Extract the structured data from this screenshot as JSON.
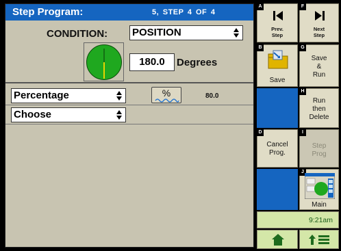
{
  "title": "Step Program:",
  "step_info": "5, STEP 4 OF 4",
  "condition": {
    "label": "CONDITION:",
    "value": "POSITION"
  },
  "degrees": {
    "value": "180.0",
    "unit": "Degrees"
  },
  "row1": {
    "select": "Percentage",
    "button": "%",
    "value": "80.0"
  },
  "row2": {
    "select": "Choose"
  },
  "buttons": {
    "prev": {
      "key": "A",
      "label1": "Prev.",
      "label2": "Step"
    },
    "next": {
      "key": "F",
      "label1": "Next",
      "label2": "Step"
    },
    "save": {
      "key": "B",
      "label": "Save"
    },
    "save_run": {
      "key": "G",
      "label1": "Save",
      "label2": "&",
      "label3": "Run"
    },
    "run_delete": {
      "key": "H",
      "label1": "Run",
      "label2": "then",
      "label3": "Delete"
    },
    "cancel": {
      "key": "D",
      "label1": "Cancel",
      "label2": "Prog."
    },
    "step_prog": {
      "key": "I",
      "label1": "Step",
      "label2": "Prog"
    },
    "main": {
      "key": "J",
      "label": "Main"
    }
  },
  "time": "9:21am",
  "colors": {
    "title_bar": "#1565c0",
    "panel": "#c8c4b1",
    "dial": "#1fa81f",
    "time_bg": "#d4e7a8"
  },
  "icons": [
    "prev-icon",
    "next-icon",
    "folder-icon",
    "main-screen-icon",
    "home-icon",
    "menu-up-icon"
  ]
}
